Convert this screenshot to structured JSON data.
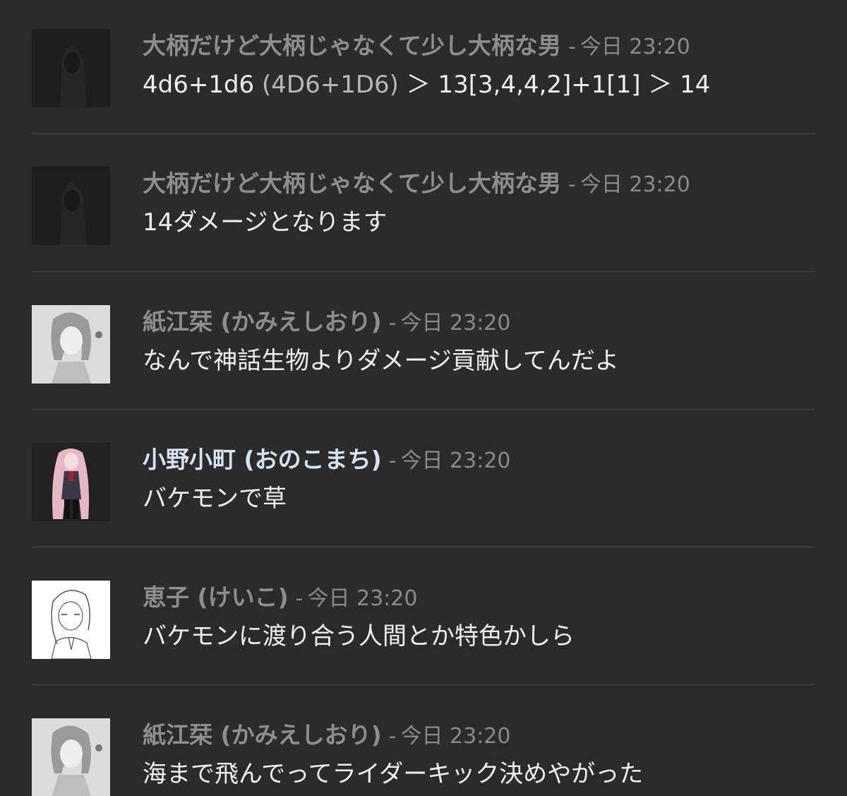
{
  "chat": {
    "messages": [
      {
        "username": "大柄だけど大柄じゃなくて少し大柄な男",
        "separator": "-",
        "timestamp": "今日 23:20",
        "text_parts": [
          "4d6+1d6",
          "(4D6+1D6)",
          "＞ 13[3,4,4,2]+1[1] ＞ 14"
        ],
        "avatar": "hooded-figure",
        "name_color": "#8e8e8e"
      },
      {
        "username": "大柄だけど大柄じゃなくて少し大柄な男",
        "separator": "-",
        "timestamp": "今日 23:20",
        "text": "14ダメージとなります",
        "avatar": "hooded-figure",
        "name_color": "#8e8e8e"
      },
      {
        "username": "紙江栞 (かみえしおり)",
        "separator": "-",
        "timestamp": "今日 23:20",
        "text": "なんで神話生物よりダメージ貢献してんだよ",
        "avatar": "sketch-girl",
        "name_color": "#8e8e8e"
      },
      {
        "username": "小野小町 (おのこまち)",
        "separator": "-",
        "timestamp": "今日 23:20",
        "text": "バケモンで草",
        "avatar": "pink-hair-girl",
        "name_color": "#d7e3f0"
      },
      {
        "username": "恵子 (けいこ)",
        "separator": "-",
        "timestamp": "今日 23:20",
        "text": "バケモンに渡り合う人間とか特色かしら",
        "avatar": "lineart-girl",
        "name_color": "#8e8e8e"
      },
      {
        "username": "紙江栞 (かみえしおり)",
        "separator": "-",
        "timestamp": "今日 23:20",
        "text": "海まで飛んでってライダーキック決めやがった",
        "avatar": "sketch-girl",
        "name_color": "#8e8e8e"
      }
    ]
  }
}
